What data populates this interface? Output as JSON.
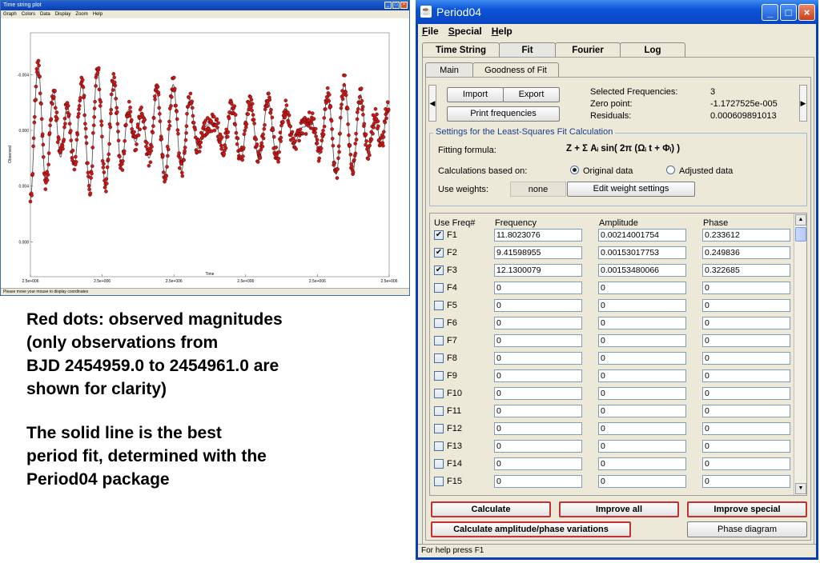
{
  "plot_window": {
    "title": "Time string plot",
    "menu": [
      "Graph",
      "Colors",
      "Data",
      "Display",
      "Zoom",
      "Help"
    ],
    "status": "Please move your mouse to display coordinates",
    "chart_data": {
      "type": "scatter",
      "xlabel": "Time",
      "ylabel": "Observed",
      "y_inverted": true,
      "x_ticks": [
        "2.5e+006",
        "2.5e+006",
        "2.5e+006",
        "2.5e+006",
        "2.5e+006",
        "2.5e+006"
      ],
      "y_ticks": [
        "-0.004",
        "0.000",
        "0.004",
        "0.008"
      ],
      "ylim": [
        -0.007,
        0.0105
      ],
      "series": [
        {
          "role": "observations",
          "color": "#cc1a1a"
        },
        {
          "role": "fit",
          "color": "#555555"
        }
      ],
      "fit_frequencies": [
        11.8023076,
        9.41598955,
        12.1300079
      ],
      "fit_amplitudes": [
        0.00214001754,
        0.00153017753,
        0.00153480066
      ],
      "fit_phases": [
        0.233612,
        0.249836,
        0.322685
      ],
      "time_range_days": [
        2454959.0,
        2454961.0
      ],
      "zero_point": -1.1727525e-05
    }
  },
  "notes": {
    "note1": "Red dots: observed magnitudes\n(only observations from\nBJD 2454959.0 to 2454961.0 are\nshown for clarity)",
    "note2": "The solid line is the best\nperiod fit, determined with the\nPeriod04 package"
  },
  "p4": {
    "title": "Period04",
    "menu": {
      "file": "File",
      "special": "Special",
      "help": "Help"
    },
    "tabs": {
      "time_string": "Time String",
      "fit": "Fit",
      "fourier": "Fourier",
      "log": "Log"
    },
    "subtabs": {
      "main": "Main",
      "goodness": "Goodness of Fit"
    },
    "buttons": {
      "import": "Import",
      "export": "Export",
      "print": "Print frequencies",
      "weights": "Edit weight settings",
      "calculate": "Calculate",
      "improve_all": "Improve all",
      "improve_special": "Improve special",
      "amp_phase": "Calculate amplitude/phase variations",
      "phase_diagram": "Phase diagram"
    },
    "stats": {
      "selected_label": "Selected Frequencies:",
      "selected_value": "3",
      "zero_label": "Zero point:",
      "zero_value": "-1.1727525e-005",
      "resid_label": "Residuals:",
      "resid_value": "0.000609891013"
    },
    "settings": {
      "legend": "Settings for the Least-Squares Fit Calculation",
      "formula_label": "Fitting formula:",
      "formula": "Z + Σ Aᵢ sin( 2π (Ωᵢ t + Φᵢ) )",
      "calc_label": "Calculations based on:",
      "opt_original": "Original data",
      "opt_adjusted": "Adjusted data",
      "weights_label": "Use weights:",
      "weights_value": "none"
    },
    "table": {
      "headers": {
        "use": "Use Freq#",
        "freq": "Frequency",
        "amp": "Amplitude",
        "phase": "Phase"
      },
      "rows": [
        {
          "name": "F1",
          "checked": true,
          "freq": "11.8023076",
          "amp": "0.00214001754",
          "phase": "0.233612"
        },
        {
          "name": "F2",
          "checked": true,
          "freq": "9.41598955",
          "amp": "0.00153017753",
          "phase": "0.249836"
        },
        {
          "name": "F3",
          "checked": true,
          "freq": "12.1300079",
          "amp": "0.00153480066",
          "phase": "0.322685"
        },
        {
          "name": "F4",
          "checked": false,
          "freq": "0",
          "amp": "0",
          "phase": "0"
        },
        {
          "name": "F5",
          "checked": false,
          "freq": "0",
          "amp": "0",
          "phase": "0"
        },
        {
          "name": "F6",
          "checked": false,
          "freq": "0",
          "amp": "0",
          "phase": "0"
        },
        {
          "name": "F7",
          "checked": false,
          "freq": "0",
          "amp": "0",
          "phase": "0"
        },
        {
          "name": "F8",
          "checked": false,
          "freq": "0",
          "amp": "0",
          "phase": "0"
        },
        {
          "name": "F9",
          "checked": false,
          "freq": "0",
          "amp": "0",
          "phase": "0"
        },
        {
          "name": "F10",
          "checked": false,
          "freq": "0",
          "amp": "0",
          "phase": "0"
        },
        {
          "name": "F11",
          "checked": false,
          "freq": "0",
          "amp": "0",
          "phase": "0"
        },
        {
          "name": "F12",
          "checked": false,
          "freq": "0",
          "amp": "0",
          "phase": "0"
        },
        {
          "name": "F13",
          "checked": false,
          "freq": "0",
          "amp": "0",
          "phase": "0"
        },
        {
          "name": "F14",
          "checked": false,
          "freq": "0",
          "amp": "0",
          "phase": "0"
        },
        {
          "name": "F15",
          "checked": false,
          "freq": "0",
          "amp": "0",
          "phase": "0"
        }
      ]
    },
    "status": "For help press F1"
  }
}
